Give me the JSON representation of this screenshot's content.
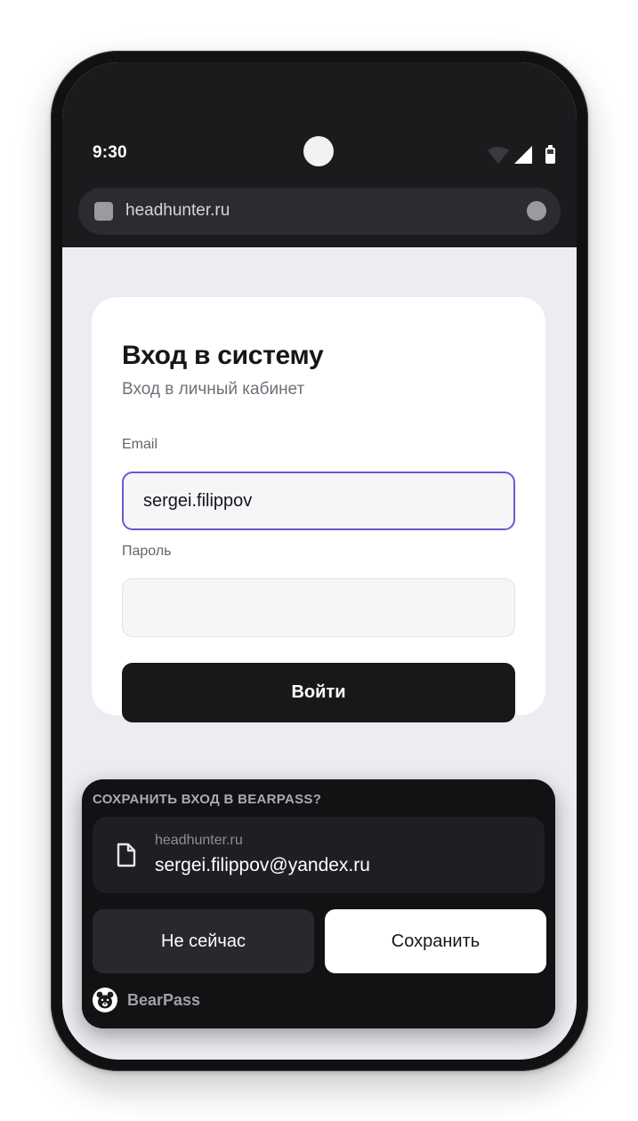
{
  "status_bar": {
    "time": "9:30",
    "icons": [
      "wifi-icon",
      "signal-icon",
      "battery-icon"
    ]
  },
  "browser": {
    "url": "headhunter.ru"
  },
  "login": {
    "title": "Вход в систему",
    "subtitle": "Вход в личный кабинет",
    "email_label": "Email",
    "email_value": "sergei.filippov",
    "password_label": "Пароль",
    "password_value": "",
    "submit_label": "Войти"
  },
  "bearpass": {
    "heading": "СОХРАНИТЬ ВХОД В BEARPASS?",
    "site": "headhunter.ru",
    "username": "sergei.filippov@yandex.ru",
    "not_now_label": "Не сейчас",
    "save_label": "Сохранить",
    "brand_name": "BearPass"
  },
  "colors": {
    "accent": "#6e57d4",
    "dark": "#18181b",
    "sheet": "#121215"
  }
}
